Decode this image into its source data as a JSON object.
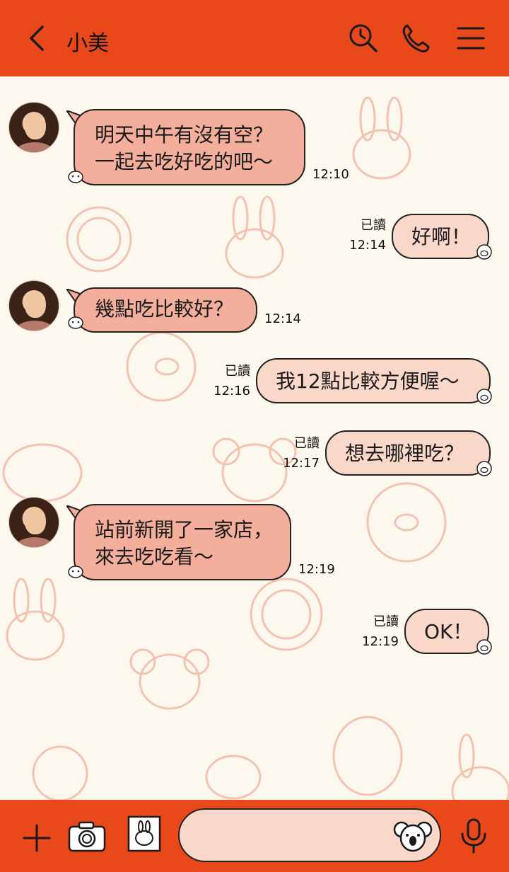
{
  "header": {
    "back_icon": "chevron-left-icon",
    "title": "小美",
    "search_icon": "search-icon",
    "phone_icon": "phone-icon",
    "menu_icon": "menu-icon",
    "background": "#e9481b"
  },
  "messages": [
    {
      "side": "in",
      "text": "明天中午有沒有空？\n一起去吃好吃的吧～",
      "time": "12:10"
    },
    {
      "side": "out",
      "text": "好啊！",
      "read": "已讀",
      "time": "12:14"
    },
    {
      "side": "in",
      "text": "幾點吃比較好？",
      "time": "12:14"
    },
    {
      "side": "out",
      "text": "我12點比較方便喔～",
      "read": "已讀",
      "time": "12:16"
    },
    {
      "side": "out",
      "text": "想去哪裡吃？",
      "read": "已讀",
      "time": "12:17"
    },
    {
      "side": "in",
      "text": "站前新開了一家店，\n來去吃吃看～",
      "time": "12:19"
    },
    {
      "side": "out",
      "text": "OK！",
      "read": "已讀",
      "time": "12:19"
    }
  ],
  "composer": {
    "plus_icon": "plus-icon",
    "camera_icon": "camera-icon",
    "photo_icon": "image-icon",
    "input_value": "",
    "sticker_icon": "koala-sticker-icon",
    "mic_icon": "microphone-icon"
  },
  "colors": {
    "accent": "#e9481b",
    "chat_background": "#fdf8ee",
    "incoming_bubble": "#f4ae9c",
    "outgoing_bubble": "#f9d7c9"
  }
}
